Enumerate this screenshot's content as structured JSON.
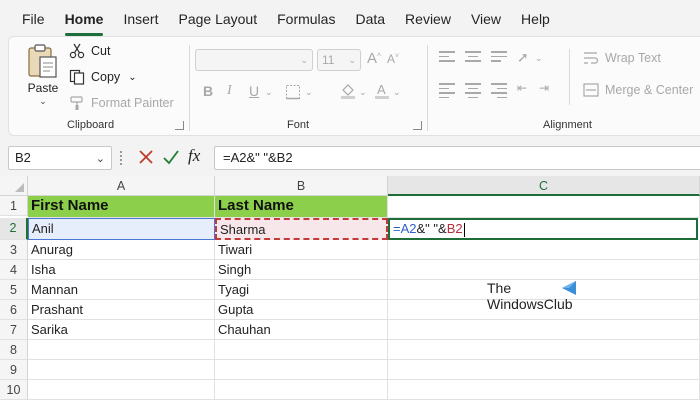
{
  "menu": {
    "tabs": [
      {
        "label": "File",
        "active": false
      },
      {
        "label": "Home",
        "active": true
      },
      {
        "label": "Insert",
        "active": false
      },
      {
        "label": "Page Layout",
        "active": false
      },
      {
        "label": "Formulas",
        "active": false
      },
      {
        "label": "Data",
        "active": false
      },
      {
        "label": "Review",
        "active": false
      },
      {
        "label": "View",
        "active": false
      },
      {
        "label": "Help",
        "active": false
      }
    ]
  },
  "ribbon": {
    "clipboard": {
      "paste_label": "Paste",
      "cut_label": "Cut",
      "copy_label": "Copy",
      "format_painter_label": "Format Painter",
      "group_label": "Clipboard"
    },
    "font": {
      "font_size": "11",
      "group_label": "Font",
      "bold": "B",
      "italic": "I",
      "underline": "U"
    },
    "alignment": {
      "wrap_text_label": "Wrap Text",
      "merge_center_label": "Merge & Center",
      "group_label": "Alignment"
    }
  },
  "formula_bar": {
    "name_box": "B2",
    "fx_label": "fx",
    "formula": "=A2&\" \"&B2"
  },
  "grid": {
    "columns": [
      "A",
      "B",
      "C"
    ],
    "rows": [
      "1",
      "2",
      "3",
      "4",
      "5",
      "6",
      "7",
      "8",
      "9",
      "10"
    ],
    "cells": [
      [
        "First Name",
        "Last Name"
      ],
      [
        "Anil",
        "Sharma"
      ],
      [
        "Anurag",
        "Tiwari"
      ],
      [
        "Isha",
        "Singh"
      ],
      [
        "Mannan",
        "Tyagi"
      ],
      [
        "Prashant",
        "Gupta"
      ],
      [
        "Sarika",
        "Chauhan"
      ]
    ],
    "editing_cell": {
      "part_eq": "=",
      "part_ref_a": "A2",
      "part_mid": "&\" \"&",
      "part_ref_b": "B2"
    }
  },
  "watermark": {
    "line1": "The",
    "line2": "WindowsClub"
  },
  "colors": {
    "accent": "#1e6e3a",
    "header_fill": "#8bcf4a",
    "ref_a": "#2d62c4",
    "ref_b": "#b2303a"
  }
}
